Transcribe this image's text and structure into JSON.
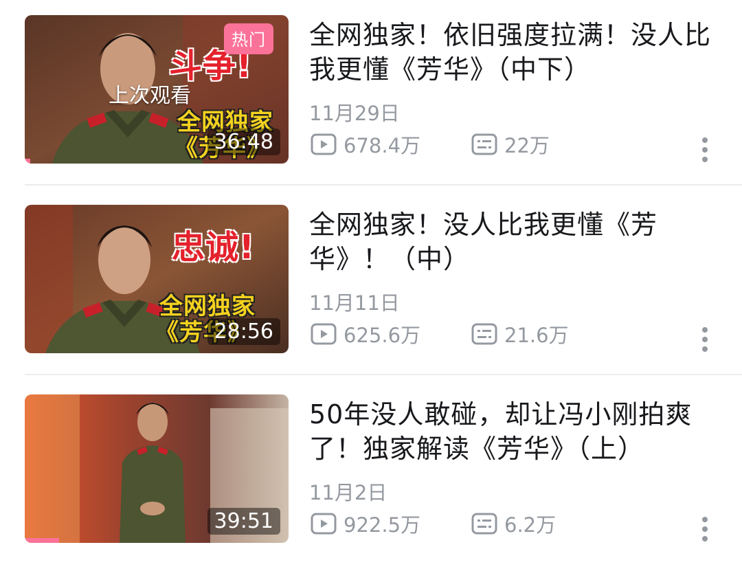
{
  "colors": {
    "accent": "#fb7299",
    "text": "#18191c",
    "meta": "#9499a0",
    "divider": "#ececec"
  },
  "icons": {
    "views": "play-count-icon",
    "danmaku": "danmaku-count-icon",
    "more": "more-vertical-icon"
  },
  "videos": [
    {
      "title": "全网独家！依旧强度拉满！没人比我更懂《芳华》（中下）",
      "date": "11月29日",
      "views": "678.4万",
      "danmaku": "22万",
      "duration": "36:48",
      "badge": "热门",
      "last_watched": "上次观看",
      "overlay_top": "斗争!",
      "overlay_line1": "全网独家",
      "overlay_line2": "《芳华》",
      "progress": 0.02
    },
    {
      "title": "全网独家！没人比我更懂《芳华》！（中）",
      "date": "11月11日",
      "views": "625.6万",
      "danmaku": "21.6万",
      "duration": "28:56",
      "overlay_top": "忠诚!",
      "overlay_line1": "全网独家",
      "overlay_line2": "《芳华》",
      "progress": 0
    },
    {
      "title": "50年没人敢碰，却让冯小刚拍爽了！独家解读《芳华》（上）",
      "date": "11月2日",
      "views": "922.5万",
      "danmaku": "6.2万",
      "duration": "39:51",
      "progress": 0.13
    }
  ]
}
